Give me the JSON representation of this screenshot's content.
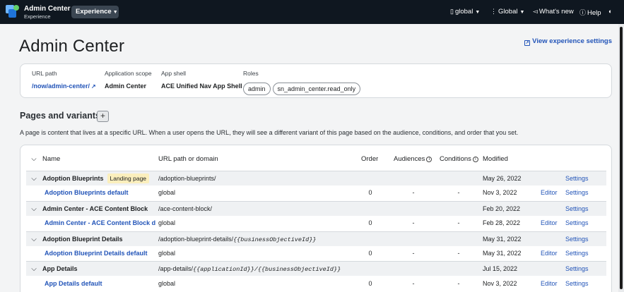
{
  "topbar": {
    "app_title": "Admin Center",
    "app_subtitle": "Experience",
    "experience_button": "Experience",
    "nav": {
      "scope": "global",
      "language": "Global",
      "whats_new": "What's new",
      "help": "Help"
    }
  },
  "page": {
    "title": "Admin Center",
    "view_settings": "View experience settings"
  },
  "info": {
    "url_path_label": "URL path",
    "url_path_value": "/now/admin-center/",
    "app_scope_label": "Application scope",
    "app_scope_value": "Admin Center",
    "app_shell_label": "App shell",
    "app_shell_value": "ACE Unified Nav App Shell",
    "roles_label": "Roles",
    "roles": [
      "admin",
      "sn_admin_center.read_only"
    ]
  },
  "pages_section": {
    "title": "Pages and variants",
    "description": "A page is content that lives at a specific URL. When a user opens the URL, they will see a different variant of this page based on the audience, conditions, and order that you set."
  },
  "table": {
    "headers": {
      "name": "Name",
      "url": "URL path or domain",
      "order": "Order",
      "audiences": "Audiences",
      "conditions": "Conditions",
      "modified": "Modified"
    },
    "rows": [
      {
        "type": "parent",
        "name": "Adoption Blueprints",
        "badge": "Landing page",
        "url": "/adoption-blueprints/",
        "url_param": "",
        "order": "",
        "audiences": "",
        "conditions": "",
        "modified": "May 26, 2022",
        "editor": "",
        "settings": "Settings"
      },
      {
        "type": "child",
        "name": "Adoption Blueprints default",
        "badge": "",
        "url": "global",
        "url_param": "",
        "order": "0",
        "audiences": "-",
        "conditions": "-",
        "modified": "Nov 3, 2022",
        "editor": "Editor",
        "settings": "Settings"
      },
      {
        "type": "parent",
        "name": "Admin Center - ACE Content Block",
        "badge": "",
        "url": "/ace-content-block/",
        "url_param": "",
        "order": "",
        "audiences": "",
        "conditions": "",
        "modified": "Feb 20, 2022",
        "editor": "",
        "settings": "Settings"
      },
      {
        "type": "child",
        "name": "Admin Center - ACE Content Block d",
        "badge": "",
        "url": "global",
        "url_param": "",
        "order": "0",
        "audiences": "-",
        "conditions": "-",
        "modified": "Feb 28, 2022",
        "editor": "Editor",
        "settings": "Settings"
      },
      {
        "type": "parent",
        "name": "Adoption Blueprint Details",
        "badge": "",
        "url": "/adoption-blueprint-details/",
        "url_param": "{{businessObjectiveId}}",
        "order": "",
        "audiences": "",
        "conditions": "",
        "modified": "May 31, 2022",
        "editor": "",
        "settings": "Settings"
      },
      {
        "type": "child",
        "name": "Adoption Blueprint Details default",
        "badge": "",
        "url": "global",
        "url_param": "",
        "order": "0",
        "audiences": "-",
        "conditions": "-",
        "modified": "May 31, 2022",
        "editor": "Editor",
        "settings": "Settings"
      },
      {
        "type": "parent",
        "name": "App Details",
        "badge": "",
        "url": "/app-details/",
        "url_param": "{{applicationId}}/{{businessObjectiveId}}",
        "order": "",
        "audiences": "",
        "conditions": "",
        "modified": "Jul 15, 2022",
        "editor": "",
        "settings": "Settings"
      },
      {
        "type": "child",
        "name": "App Details default",
        "badge": "",
        "url": "global",
        "url_param": "",
        "order": "0",
        "audiences": "-",
        "conditions": "-",
        "modified": "Nov 3, 2022",
        "editor": "Editor",
        "settings": "Settings"
      }
    ]
  }
}
